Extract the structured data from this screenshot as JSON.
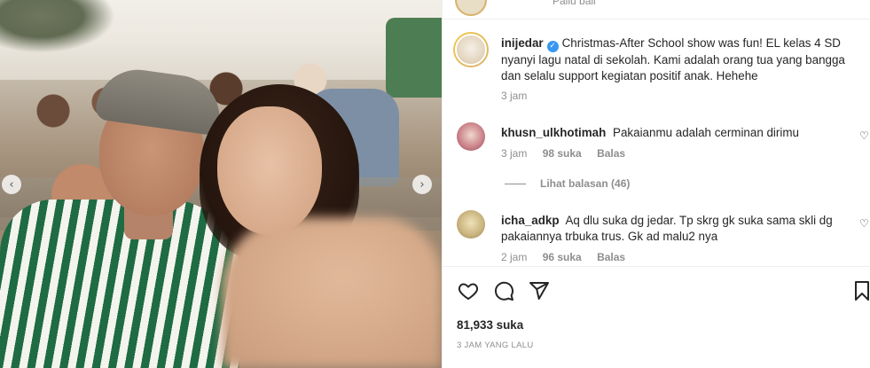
{
  "top_strip": {
    "text": "Pallu bali"
  },
  "photo": {
    "carousel_prev": "‹",
    "carousel_next": "›"
  },
  "post": {
    "username": "inijedar",
    "caption": "Christmas-After School show was fun! EL kelas 4 SD nyanyi lagu natal di sekolah. Kami adalah orang tua yang bangga dan selalu support kegiatan positif anak. Hehehe",
    "time": "3 jam",
    "likes": "81,933 suka",
    "posted_ago": "3 JAM YANG LALU"
  },
  "comments": [
    {
      "username": "khusn_ulkhotimah",
      "text": "Pakaianmu adalah cerminan dirimu",
      "time": "3 jam",
      "likes": "98 suka",
      "reply": "Balas",
      "view_replies": "Lihat balasan (46)"
    },
    {
      "username": "icha_adkp",
      "text": "Aq dlu suka dg jedar. Tp skrg gk suka sama skli dg pakaiannya trbuka trus. Gk ad malu2 nya",
      "time": "2 jam",
      "likes": "96 suka",
      "reply": "Balas"
    }
  ],
  "icons": {
    "like": "heart-icon",
    "comment": "comment-bubble-icon",
    "share": "paper-plane-icon",
    "save": "bookmark-icon",
    "verified": "verified-badge-icon"
  },
  "colors": {
    "verified": "#3897f0",
    "muted": "#8e8e8e",
    "text": "#262626"
  }
}
